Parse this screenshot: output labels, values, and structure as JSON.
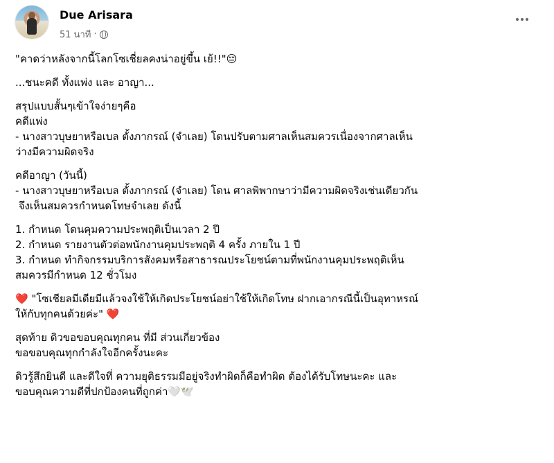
{
  "post": {
    "author": "Due Arisara",
    "time": "51 นาที",
    "separator": "·",
    "paragraphs": [
      [
        "\"คาดว่าหลังจากนี้โลกโซเชี่ยลคงน่าอยู่ขึ้น เย้!!\"😔"
      ],
      [
        "...ชนะคดี ทั้งแพ่ง และ อาญา..."
      ],
      [
        "สรุปแบบสั้นๆเข้าใจง่ายๆคือ",
        "คดีแพ่ง",
        "- นางสาวบุษยาหรือเบล ตั้งภากรณ์ (จำเลย) โดนปรับตามศาลเห็นสมควรเนื่องจากศาลเห็น",
        "ว่างมีความผิดจริง"
      ],
      [
        "คดีอาญา (วันนี้)",
        "- นางสาวบุษยาหรือเบล ตั้งภากรณ์ (จำเลย) โดน ศาลพิพากษาว่ามีความผิดจริงเช่นเดียวกัน",
        "￼ จึงเห็นสมควรกำหนดโทษจำเลย ดังนี้"
      ],
      [
        "1. กำหนด โดนคุมความประพฤติเป็นเวลา￼ 2 ปี",
        "2.￼￼ กำหนด รายงานตัวต่อพนักงานคุมประพฤติ 4 ครั้ง ภายใน 1 ปี",
        "3. กำหนด ทำกิจกรรมบริการสังคมหรือสาธารณประโยชน์ตามที่พนักงานคุมประพฤติเห็น",
        "สมควรมีกำหนด 12 ชั่วโมง"
      ],
      [
        "❤️ \"โซเชียลมีเดียมีแล้วจงใช้ให้เกิดประโยชน์อย่าใช้ให้เกิดโทษ ฝากเอากรณีนี้เป็นอุทาหรณ์",
        "ให้กับทุกคนด้วยค่ะ￼\" ❤️"
      ],
      [
        "สุดท้าย ดิวขอขอบคุณทุกคน ที่มี ส่วนเกี่ยวข้อง",
        "ขอขอบคุณ￼￼ทุกกำลังใจอีกครั้งนะคะ"
      ],
      [
        "ดิวรู้สึกยินดี และดีใจที่ ความยุติธรรมมีอยู่จริงทำผิดก็คือทำผิด ￼ต้องได้รับโทษนะคะ และ",
        "ขอบคุณความดีที่ปกป้องคนที่￼ถูกค่า🤍🕊️"
      ]
    ]
  }
}
